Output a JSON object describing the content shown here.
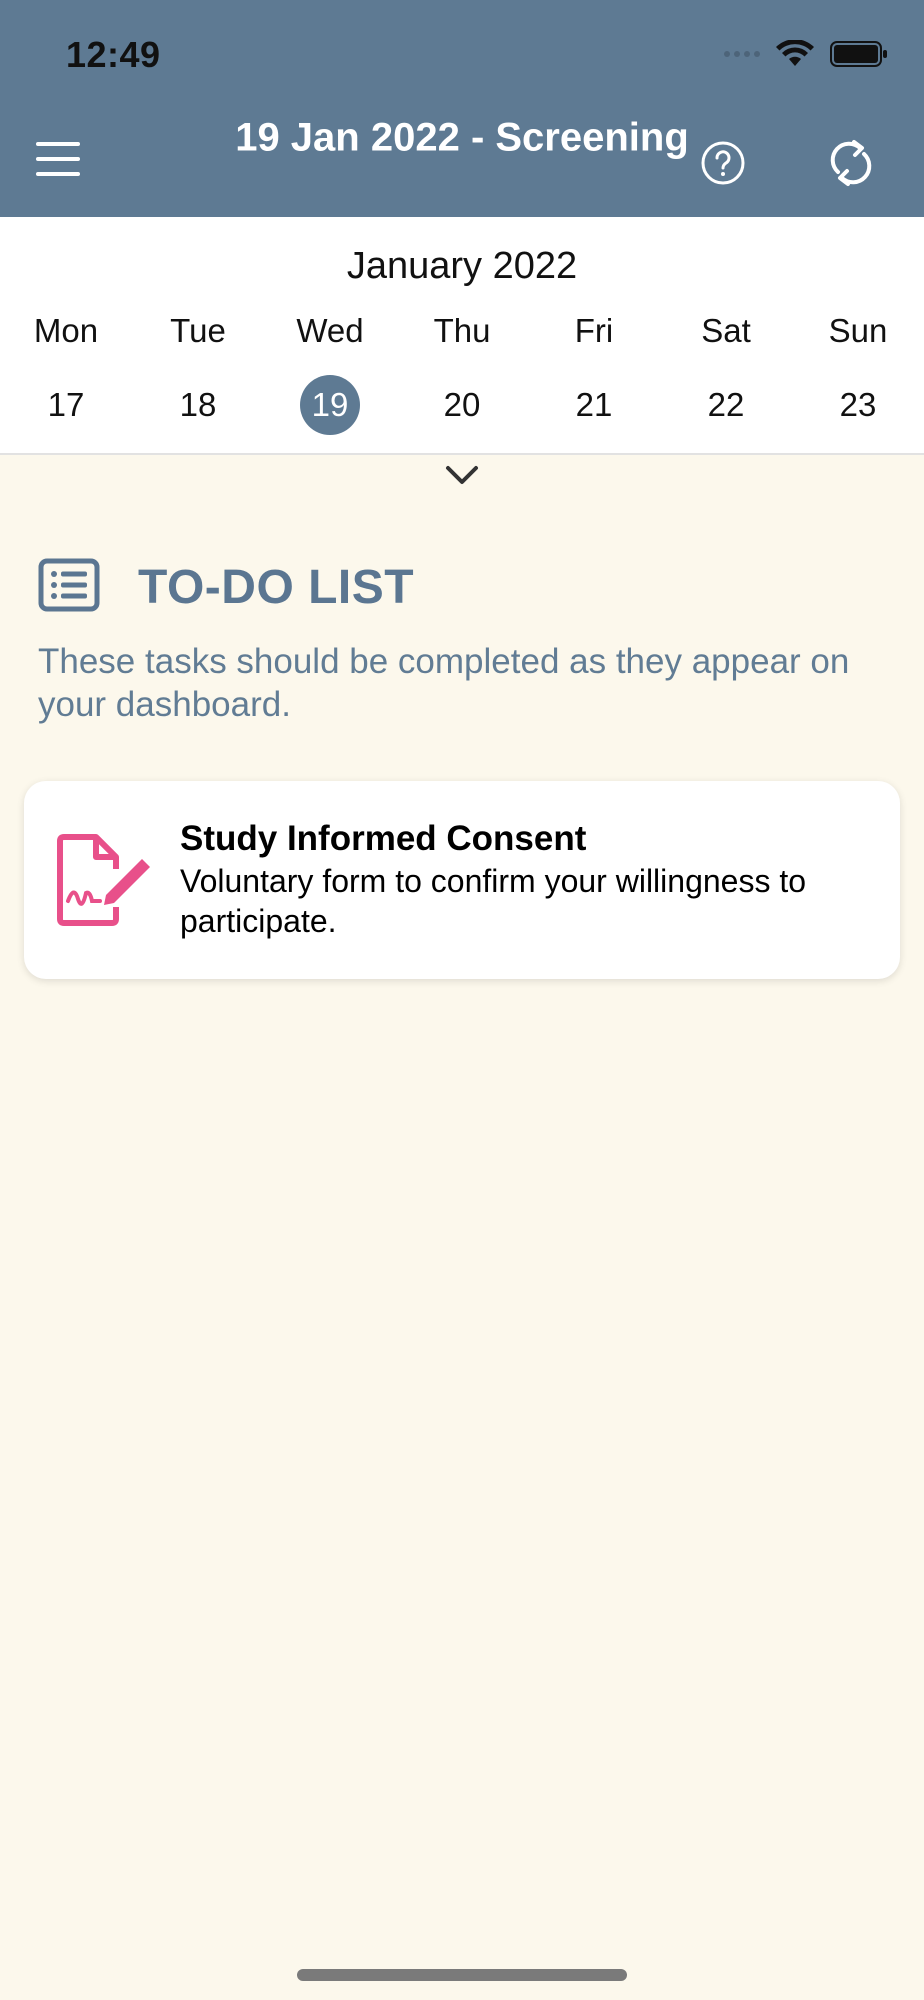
{
  "status_bar": {
    "time": "12:49"
  },
  "header": {
    "title": "19 Jan 2022 - Screening"
  },
  "calendar": {
    "month_label": "January 2022",
    "days": [
      {
        "name": "Mon",
        "date": "17",
        "selected": false
      },
      {
        "name": "Tue",
        "date": "18",
        "selected": false
      },
      {
        "name": "Wed",
        "date": "19",
        "selected": true
      },
      {
        "name": "Thu",
        "date": "20",
        "selected": false
      },
      {
        "name": "Fri",
        "date": "21",
        "selected": false
      },
      {
        "name": "Sat",
        "date": "22",
        "selected": false
      },
      {
        "name": "Sun",
        "date": "23",
        "selected": false
      }
    ]
  },
  "todo": {
    "title": "TO-DO LIST",
    "description": "These tasks should be completed as they appear on your dashboard.",
    "tasks": [
      {
        "title": "Study Informed Consent",
        "description": "Voluntary form to confirm your willingness to participate.",
        "icon": "signed-document-icon"
      }
    ]
  },
  "colors": {
    "header_bg": "#5e7a93",
    "page_bg": "#fcf8ec",
    "accent_text": "#5b7691",
    "task_icon": "#e8508a"
  }
}
